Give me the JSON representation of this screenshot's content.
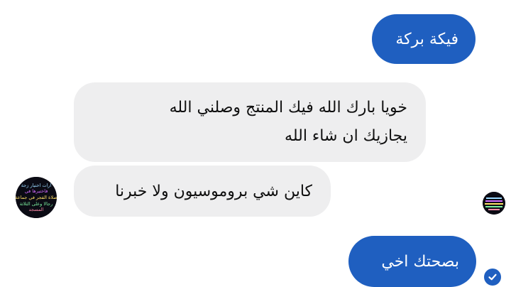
{
  "conversation": {
    "messages": [
      {
        "id": "m1",
        "direction": "outgoing",
        "text": "فيكة بركة"
      },
      {
        "id": "m2",
        "direction": "incoming",
        "lines": [
          "خويا بارك الله فيك المنتج وصلني الله",
          "يجازيك ان شاء الله"
        ]
      },
      {
        "id": "m3",
        "direction": "incoming",
        "text": "كاين شي بروموسيون ولا خبرنا"
      },
      {
        "id": "m4",
        "direction": "outgoing",
        "text": "بصحتك اخي"
      }
    ],
    "avatar_text": [
      "ارات اختيار زجة",
      "فاختيرها في",
      "صلاة الفجر في جماعة",
      "رجالا وعلى الثلاثة",
      "المسجد"
    ]
  },
  "colors": {
    "outgoing_bubble": "#1f5fc0",
    "incoming_bubble": "#eeeeef",
    "seen_check": "#1f5fc0"
  },
  "icons": {
    "seen_indicator": "check-circle-icon"
  }
}
